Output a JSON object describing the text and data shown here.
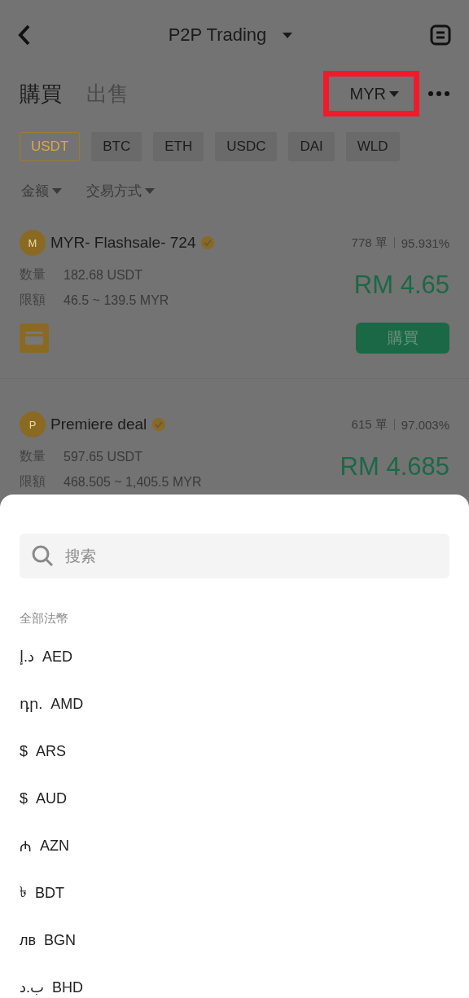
{
  "header": {
    "title": "P2P Trading"
  },
  "trade_tabs": [
    {
      "label": "購買",
      "selected": true
    },
    {
      "label": "出售",
      "selected": false
    }
  ],
  "currency_selector": {
    "label": "MYR"
  },
  "coins": [
    {
      "label": "USDT",
      "selected": true
    },
    {
      "label": "BTC",
      "selected": false
    },
    {
      "label": "ETH",
      "selected": false
    },
    {
      "label": "USDC",
      "selected": false
    },
    {
      "label": "DAI",
      "selected": false
    },
    {
      "label": "WLD",
      "selected": false
    }
  ],
  "filters": [
    {
      "label": "金额"
    },
    {
      "label": "交易方式"
    }
  ],
  "offers": [
    {
      "avatar": "M",
      "name": "MYR- Flashsale- 724",
      "verified": true,
      "orders": "778 單",
      "completion": "95.931%",
      "quantity_label": "数量",
      "quantity": "182.68  USDT",
      "limit_label": "限額",
      "limit": "46.5 ~ 139.5 MYR",
      "price": "RM 4.65",
      "action": "購買"
    },
    {
      "avatar": "P",
      "name": "Premiere deal",
      "verified": true,
      "orders": "615 單",
      "completion": "97.003%",
      "quantity_label": "数量",
      "quantity": "597.65  USDT",
      "limit_label": "限額",
      "limit": "468.505 ~ 1,405.5 MYR",
      "price": "RM 4.685"
    }
  ],
  "sheet": {
    "search": {
      "placeholder": "搜索"
    },
    "section_label": "全部法幣",
    "currencies": [
      {
        "symbol": "د.إ",
        "code": "AED"
      },
      {
        "symbol": "դր.",
        "code": "AMD"
      },
      {
        "symbol": "$",
        "code": "ARS"
      },
      {
        "symbol": "$",
        "code": "AUD"
      },
      {
        "symbol": "₼",
        "code": "AZN"
      },
      {
        "symbol": "৳",
        "code": "BDT"
      },
      {
        "symbol": "лв",
        "code": "BGN"
      },
      {
        "symbol": "ب.د",
        "code": "BHD"
      }
    ]
  }
}
